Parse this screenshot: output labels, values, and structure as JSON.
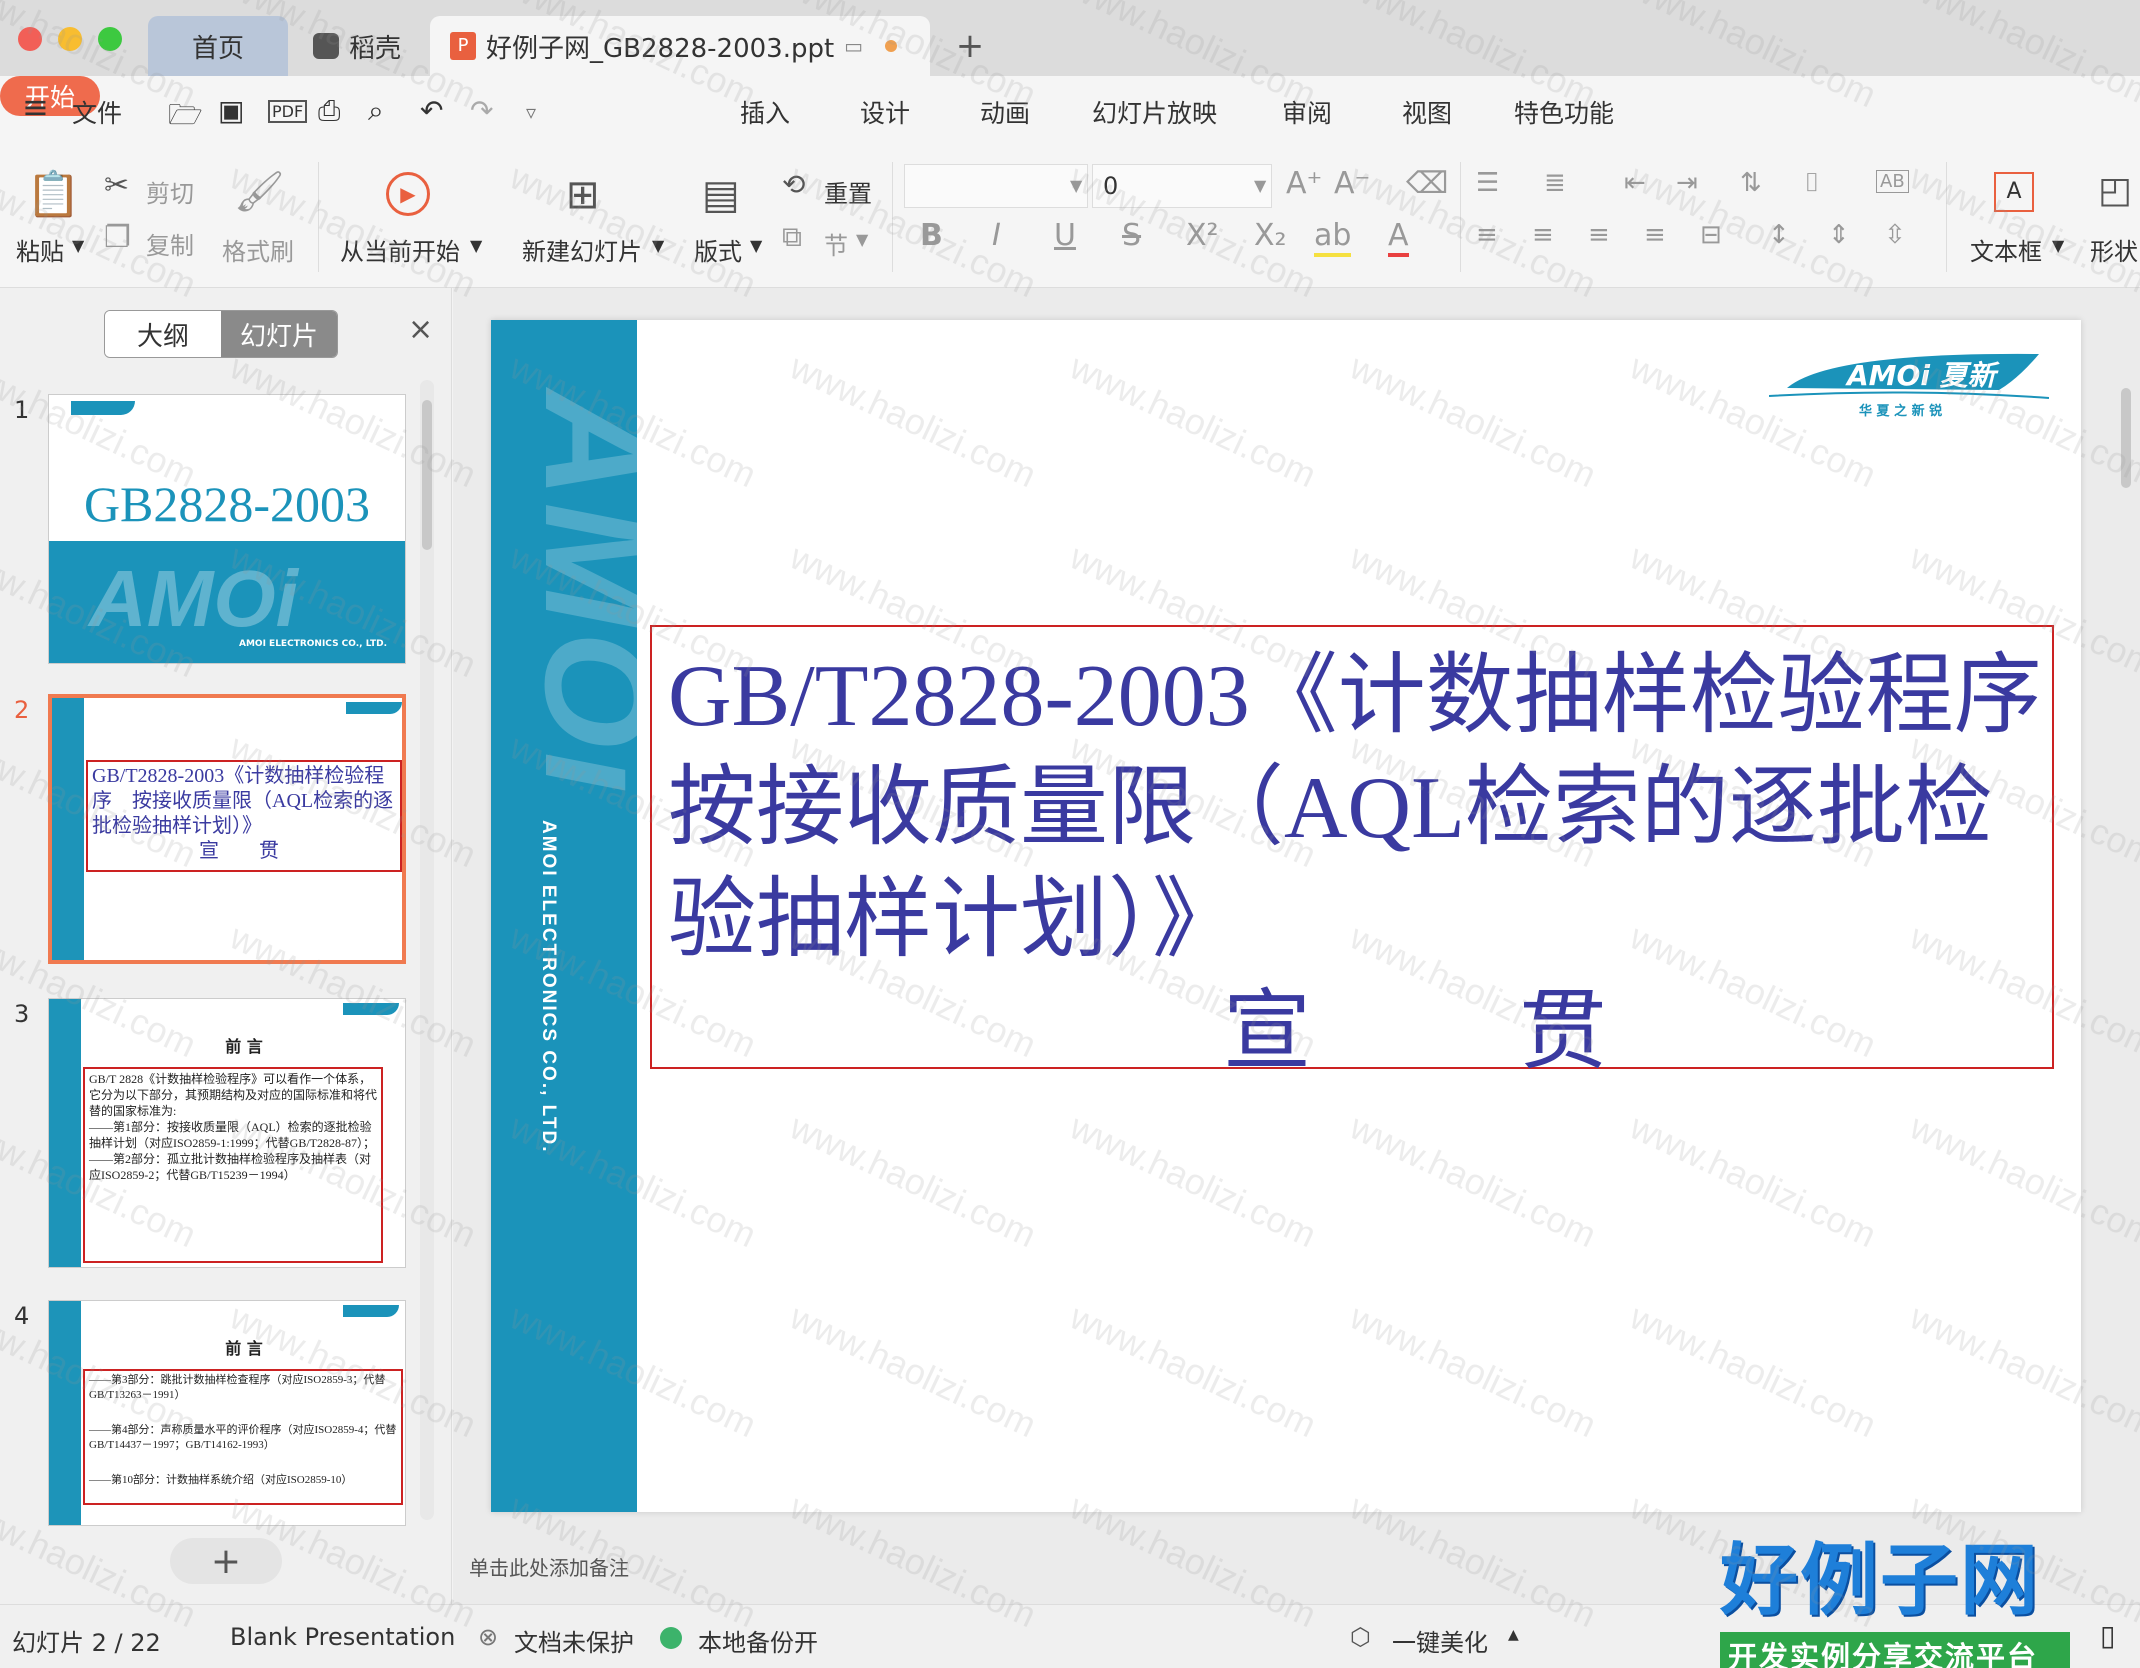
{
  "window": {
    "tabs": [
      {
        "label": "首页"
      },
      {
        "label": "稻壳"
      },
      {
        "label": "好例子网_GB2828-2003.ppt"
      }
    ],
    "new_tab": "+"
  },
  "menu": {
    "hamburger": "≡",
    "file": "文件",
    "tabs": [
      "开始",
      "插入",
      "设计",
      "动画",
      "幻灯片放映",
      "审阅",
      "视图",
      "特色功能"
    ]
  },
  "ribbon": {
    "paste": "粘贴",
    "cut": "剪切",
    "copy": "复制",
    "format_painter": "格式刷",
    "from_current": "从当前开始",
    "new_slide": "新建幻灯片",
    "layout": "版式",
    "reset": "重置",
    "section": "节",
    "font_name": "",
    "font_size": "0",
    "textbox": "文本框",
    "shape": "形状"
  },
  "left_panel": {
    "outline_tab": "大纲",
    "slides_tab": "幻灯片",
    "close": "×",
    "add": "+",
    "thumbnails": [
      {
        "num": "1",
        "title": "GB2828-2003",
        "logo_text": "AMOi",
        "company": "AMOI ELECTRONICS CO., LTD."
      },
      {
        "num": "2",
        "title": "GB/T2828-2003《计数抽样检验程序　按接收质量限（AQL检索的逐批检验抽样计划）》",
        "sub": "宣　贯"
      },
      {
        "num": "3",
        "heading": "前 言",
        "lines": [
          "GB/T 2828《计数抽样检验程序》可以看作一个体系，它分为以下部分，其预期结构及对应的国际标准和将代替的国家标准为:",
          "——第1部分：按接收质量限（AQL）检索的逐批检验抽样计划（对应ISO2859-1:1999；代替GB/T2828-87）；",
          "——第2部分：孤立批计数抽样检验程序及抽样表（对应ISO2859-2；代替GB/T15239－1994）"
        ]
      },
      {
        "num": "4",
        "heading": "前 言",
        "lines": [
          "——第3部分：跳批计数抽样检查程序（对应ISO2859-3；代替GB/T13263－1991）",
          "——第4部分：声称质量水平的评价程序（对应ISO2859-4；代替GB/T14437－1997；GB/T14162-1993）",
          "——第10部分：计数抽样系统介绍（对应ISO2859-10）"
        ]
      }
    ]
  },
  "slide": {
    "title": "GB/T2828-2003《计数抽样检验程序　 按接收质量限（AQL检索的逐批检验抽样计划）》",
    "sub": "宣　贯",
    "logo_text": "AMOi 夏新",
    "logo_tagline": "华 夏 之 新 锐",
    "strip_logo": "AMOi",
    "strip_company": "AMOI ELECTRONICS CO., LTD.",
    "notes_hint": "单击此处添加备注"
  },
  "status": {
    "slide_counter": "幻灯片 2 / 22",
    "theme": "Blank Presentation",
    "doc_protect": "文档未保护",
    "local_backup": "本地备份开",
    "beautify": "一键美化"
  },
  "brand": {
    "title": "好例子网",
    "subtitle": "开发实例分享交流平台",
    "watermark": "www.haolizi.com"
  },
  "colors": {
    "accent": "#ef6b4d",
    "strip": "#1b93ba",
    "title_text": "#3a3aa0",
    "box_border": "#cc2222"
  }
}
